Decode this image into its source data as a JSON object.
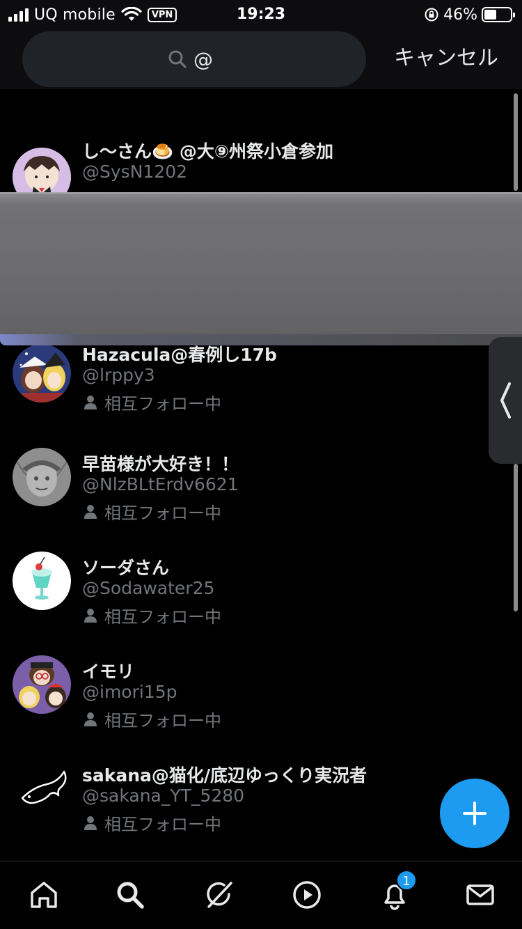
{
  "status_bar": {
    "carrier": "UQ mobile",
    "vpn": "VPN",
    "time": "19:23",
    "battery_percent": "46%",
    "battery_level": 0.46
  },
  "search": {
    "query": "@",
    "cancel_label": "キャンセル"
  },
  "users": [
    {
      "display_name": "し〜さん🍮 @大⑨州祭小倉参加",
      "handle": "@SysN1202",
      "mutual": ""
    },
    {
      "display_name": "Hazacula@春例し17b",
      "handle": "@lrppy3",
      "mutual": "相互フォロー中"
    },
    {
      "display_name": "早苗様が大好き！！",
      "handle": "@NlzBLtErdv6621",
      "mutual": "相互フォロー中"
    },
    {
      "display_name": "ソーダさん",
      "handle": "@Sodawater25",
      "mutual": "相互フォロー中"
    },
    {
      "display_name": "イモリ",
      "handle": "@imori15p",
      "mutual": "相互フォロー中"
    },
    {
      "display_name": "sakana@猫化/底辺ゆっくり実況者",
      "handle": "@sakana_YT_5280",
      "mutual": "相互フォロー中"
    }
  ],
  "tab_bar": {
    "items": [
      "home-icon",
      "search-icon",
      "grok-icon",
      "video-icon",
      "notifications-icon",
      "messages-icon"
    ],
    "notification_count": "1"
  },
  "colors": {
    "accent": "#1d9bf0",
    "background": "#000000",
    "secondary_text": "#71767b"
  }
}
